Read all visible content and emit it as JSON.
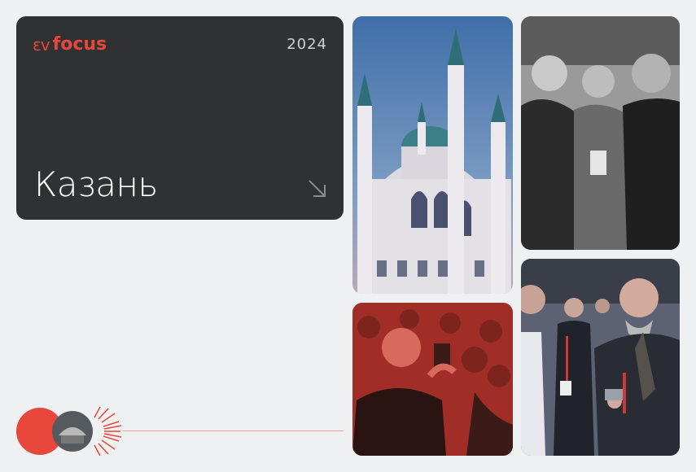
{
  "card": {
    "brand_mark": "ɛv",
    "brand_name": "focus",
    "year": "2024",
    "city": "Казань"
  },
  "icons": {
    "arrow": "arrow-down-right-icon"
  },
  "colors": {
    "accent": "#e8473b",
    "card_bg": "#2f3133",
    "page_bg": "#eff0f2"
  }
}
